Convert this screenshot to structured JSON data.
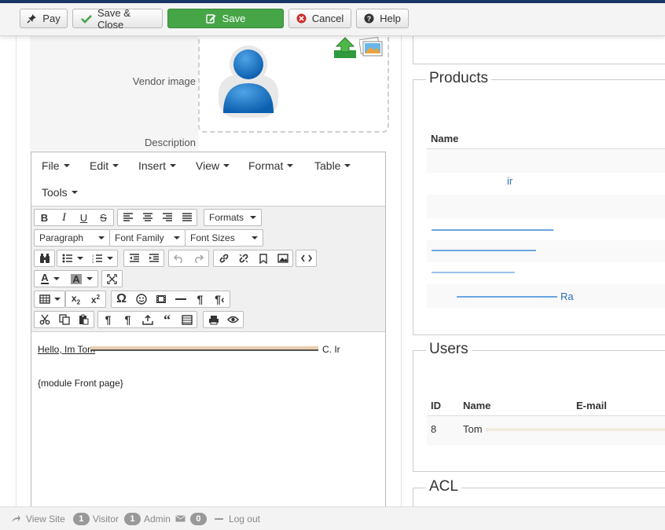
{
  "toolbar": {
    "pay_label": "Pay",
    "save_close_label": "Save & Close",
    "save_label": "Save",
    "cancel_label": "Cancel",
    "help_label": "Help"
  },
  "vendor": {
    "image_label": "Vendor image",
    "description_label": "Description"
  },
  "editor": {
    "menus": [
      "File",
      "Edit",
      "Insert",
      "View",
      "Format",
      "Table",
      "Tools"
    ],
    "formats_label": "Formats",
    "paragraph_label": "Paragraph",
    "font_family_label": "Font Family",
    "font_sizes_label": "Font Sizes",
    "content_line1_start": "Hello, Im Tom",
    "content_line1_end": "C. Ir",
    "content_line2": "{module Front page}"
  },
  "products": {
    "title": "Products",
    "column_name": "Name",
    "visible_fragments": [
      "ir",
      "Ra"
    ]
  },
  "users": {
    "title": "Users",
    "columns": [
      "ID",
      "Name",
      "E-mail"
    ],
    "rows": [
      {
        "id": "8",
        "name": "Tom"
      }
    ]
  },
  "acl": {
    "title": "ACL"
  },
  "footer": {
    "view_site_label": "View Site",
    "visitor_count": "1",
    "visitor_label": "Visitor",
    "admin_count": "1",
    "admin_label": "Admin",
    "messages_count": "0",
    "logout_label": "Log out"
  },
  "colors": {
    "save_green": "#46a546",
    "cancel_red": "#c9302c",
    "link_blue": "#2a6ebb"
  }
}
